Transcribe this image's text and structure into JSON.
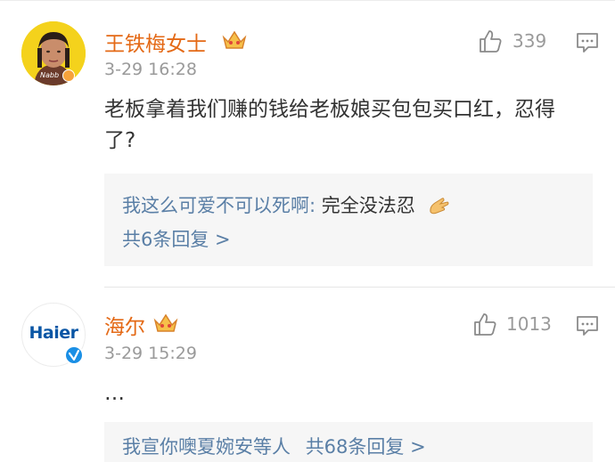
{
  "comments": [
    {
      "username": "王铁梅女士",
      "time": "3-29 16:28",
      "likes": "339",
      "avatar_caption": "Nabb",
      "text": "老板拿着我们赚的钱给老板娘买包包买口红，忍得了?",
      "reply": {
        "author": "我这么可爱不可以死啊:",
        "text": "完全没法忍",
        "emoji": "clasped-hands-icon",
        "count_label": "共6条回复 >"
      }
    },
    {
      "username": "海尔",
      "time": "3-29 15:29",
      "likes": "1013",
      "avatar_logo": "Haier",
      "text": "…",
      "reply": {
        "authors": "我宣你噢夏婉安等人",
        "count_label": "共68条回复 >"
      }
    }
  ],
  "colors": {
    "username": "#e46a17",
    "link_blue": "#5a7fa6",
    "meta_gray": "#9a9a9a",
    "reply_bg": "#f6f6f6",
    "verified_blue": "#1a8fe5",
    "crown_gold": "#f0a53a"
  }
}
